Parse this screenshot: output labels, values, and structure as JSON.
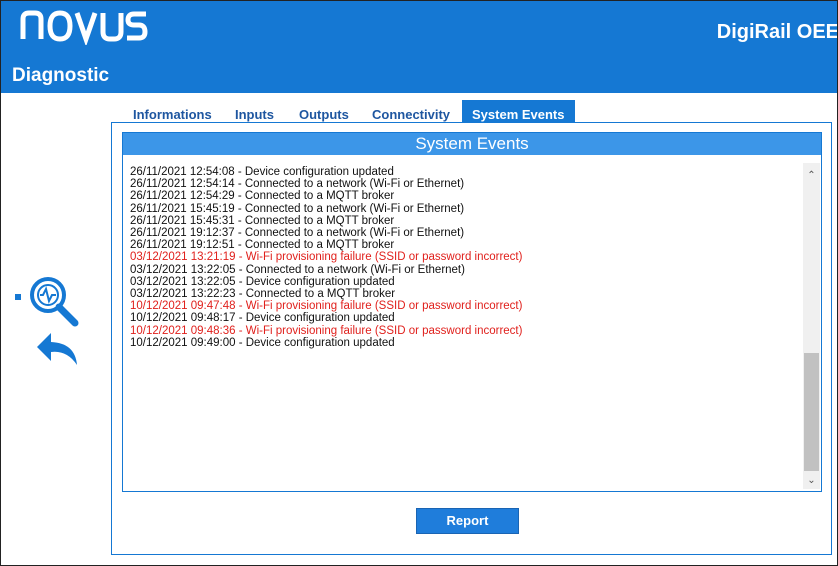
{
  "header": {
    "logo": "NOVUS",
    "subtitle": "Diagnostic",
    "product": "DigiRail OEE"
  },
  "tabs": [
    {
      "label": "Informations",
      "active": false
    },
    {
      "label": "Inputs",
      "active": false
    },
    {
      "label": "Outputs",
      "active": false
    },
    {
      "label": "Connectivity",
      "active": false
    },
    {
      "label": "System Events",
      "active": true
    }
  ],
  "events": {
    "title": "System Events",
    "entries": [
      {
        "text": "26/11/2021 12:54:08 - Device configuration updated",
        "error": false
      },
      {
        "text": "26/11/2021 12:54:14 - Connected to a network (Wi-Fi or Ethernet)",
        "error": false
      },
      {
        "text": "26/11/2021 12:54:29 - Connected to a MQTT broker",
        "error": false
      },
      {
        "text": "26/11/2021 15:45:19 - Connected to a network (Wi-Fi or Ethernet)",
        "error": false
      },
      {
        "text": "26/11/2021 15:45:31 - Connected to a MQTT broker",
        "error": false
      },
      {
        "text": "26/11/2021 19:12:37 - Connected to a network (Wi-Fi or Ethernet)",
        "error": false
      },
      {
        "text": "26/11/2021 19:12:51 - Connected to a MQTT broker",
        "error": false
      },
      {
        "text": "03/12/2021 13:21:19 - Wi-Fi provisioning failure (SSID or password incorrect)",
        "error": true
      },
      {
        "text": "03/12/2021 13:22:05 - Connected to a network (Wi-Fi or Ethernet)",
        "error": false
      },
      {
        "text": "03/12/2021 13:22:05 - Device configuration updated",
        "error": false
      },
      {
        "text": "03/12/2021 13:22:23 - Connected to a MQTT broker",
        "error": false
      },
      {
        "text": "10/12/2021 09:47:48 - Wi-Fi provisioning failure (SSID or password incorrect)",
        "error": true
      },
      {
        "text": "10/12/2021 09:48:17 - Device configuration updated",
        "error": false
      },
      {
        "text": "10/12/2021 09:48:36 - Wi-Fi provisioning failure (SSID or password incorrect)",
        "error": true
      },
      {
        "text": "10/12/2021 09:49:00 - Device configuration updated",
        "error": false
      }
    ]
  },
  "report_button": "Report",
  "icons": {
    "diagnostic": "magnifier-pulse-icon",
    "back": "back-arrow-icon",
    "scroll_up": "chevron-up-icon",
    "scroll_down": "chevron-down-icon"
  },
  "colors": {
    "brand": "#1578d3",
    "error_text": "#e0201c"
  }
}
